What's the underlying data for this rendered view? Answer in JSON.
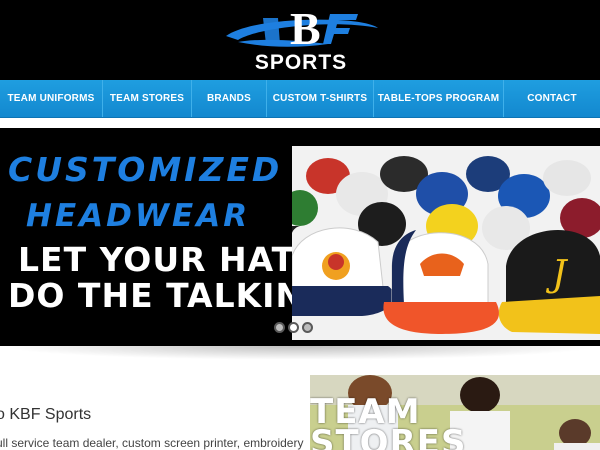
{
  "brand": {
    "logo_letters": "KBF",
    "logo_label": "SPORTS",
    "colors": {
      "accent": "#1e7fe0",
      "nav": "#1388cf",
      "header_bg": "#000000"
    }
  },
  "nav": {
    "items": [
      {
        "label": "TEAM UNIFORMS"
      },
      {
        "label": "TEAM STORES"
      },
      {
        "label": "BRANDS"
      },
      {
        "label": "CUSTOM T-SHIRTS"
      },
      {
        "label": "TABLE-TOPS PROGRAM"
      },
      {
        "label": "CONTACT"
      }
    ]
  },
  "hero": {
    "line1": "CUSTOMIZED",
    "line2": "HEADWEAR",
    "line3": "LET YOUR HAT",
    "line4": "DO THE TALKING",
    "image": "baseball-caps-photo",
    "slides": 3,
    "active_slide": 2
  },
  "content": {
    "welcome": "o KBF Sports",
    "intro": "ull service team dealer, custom screen printer, embroidery"
  },
  "promo": {
    "title_line1": "TEAM",
    "title_line2": "STORES"
  }
}
